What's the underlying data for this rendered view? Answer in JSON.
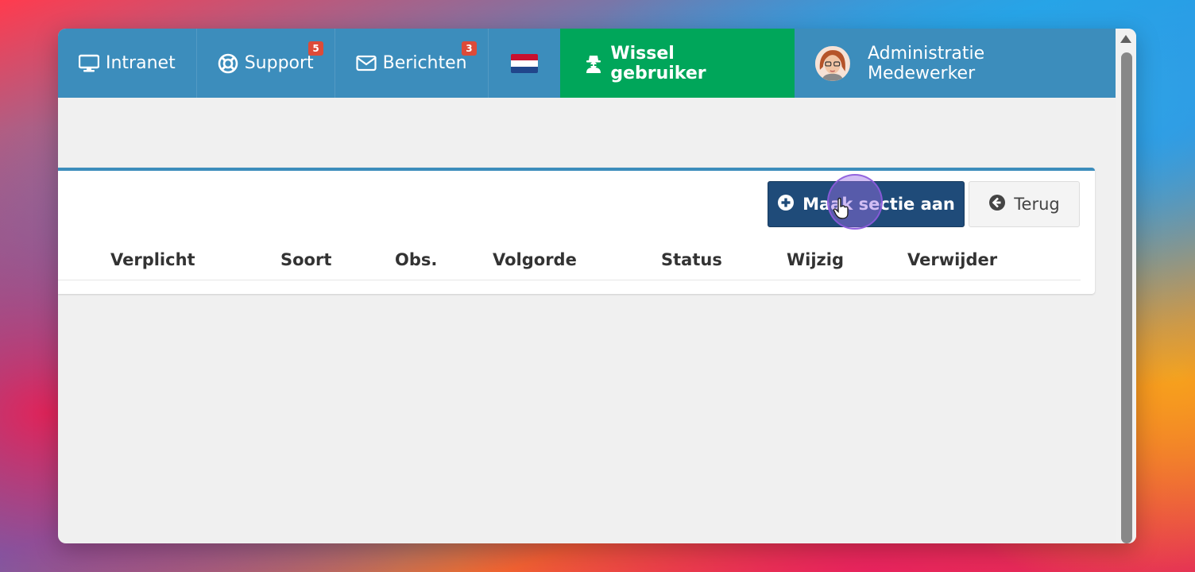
{
  "navbar": {
    "intranet_label": "Intranet",
    "support_label": "Support",
    "support_badge": "5",
    "messages_label": "Berichten",
    "messages_badge": "3",
    "switch_user_label": "Wissel gebruiker",
    "user_name": "Administratie Medewerker"
  },
  "toolbar": {
    "create_section_label": "Maak sectie aan",
    "back_label": "Terug"
  },
  "table": {
    "columns": [
      "Verplicht",
      "Soort",
      "Obs.",
      "Volgorde",
      "Status",
      "Wijzig",
      "Verwijder"
    ]
  },
  "colors": {
    "navbar": "#3c8dbc",
    "switch_user": "#00a65a",
    "primary_button": "#1f4b79",
    "badge": "#dd4b39"
  },
  "icons": {
    "intranet": "monitor-icon",
    "support": "lifebuoy-icon",
    "messages": "envelope-icon",
    "language": "flag-nl-icon",
    "switch_user": "user-secret-icon",
    "create": "plus-circle-icon",
    "back": "arrow-circle-left-icon"
  }
}
